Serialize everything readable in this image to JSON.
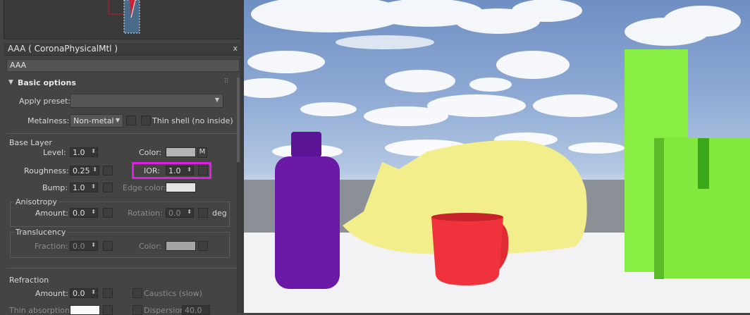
{
  "panel": {
    "title": "AAA  ( CoronaPhysicalMtl )",
    "close": "x",
    "name_value": "AAA"
  },
  "basic": {
    "header": "Basic options",
    "apply_preset_label": "Apply preset:",
    "apply_preset_value": "",
    "metalness_label": "Metalness:",
    "metalness_value": "Non-metal",
    "thin_shell_label": "Thin shell (no inside)"
  },
  "base": {
    "header": "Base Layer",
    "level_label": "Level:",
    "level_value": "1.0",
    "color_label": "Color:",
    "color_m": "M",
    "roughness_label": "Roughness:",
    "roughness_value": "0.25",
    "ior_label": "IOR:",
    "ior_value": "1.0",
    "bump_label": "Bump:",
    "bump_value": "1.0",
    "edge_color_label": "Edge color:"
  },
  "aniso": {
    "header": "Anisotropy",
    "amount_label": "Amount:",
    "amount_value": "0.0",
    "rotation_label": "Rotation:",
    "rotation_value": "0.0",
    "deg": "deg"
  },
  "trans": {
    "header": "Translucency",
    "fraction_label": "Fraction:",
    "fraction_value": "0.0",
    "color_label": "Color:"
  },
  "refr": {
    "header": "Refraction",
    "amount_label": "Amount:",
    "amount_value": "0.0",
    "caustics_label": "Caustics (slow)",
    "thin_abs_label": "Thin absorption:",
    "dispersion_label": "Dispersion",
    "dispersion_value": "40.0"
  },
  "colors": {
    "highlight": "#e020e0",
    "bottle": "#6a1aa6",
    "blob": "#f2ee8c",
    "mug": "#f0323c",
    "green": "#88ee44"
  }
}
